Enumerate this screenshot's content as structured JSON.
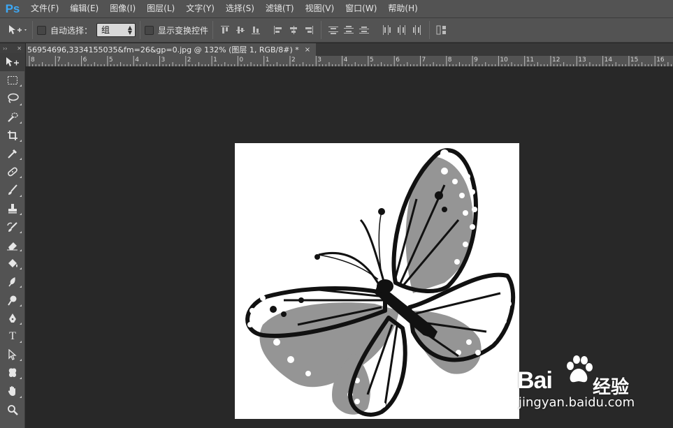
{
  "app": {
    "logo": "Ps"
  },
  "menu": [
    "文件(F)",
    "编辑(E)",
    "图像(I)",
    "图层(L)",
    "文字(Y)",
    "选择(S)",
    "滤镜(T)",
    "视图(V)",
    "窗口(W)",
    "帮助(H)"
  ],
  "options": {
    "auto_select_label": "自动选择：",
    "auto_select_value": "组",
    "show_transform_label": "显示变换控件"
  },
  "toolpanel": {
    "collapse": "››",
    "close": "✕"
  },
  "document": {
    "tab_title": "56954696,3334155035&fm=26&gp=0.jpg @ 132% (图层 1, RGB/8#) *",
    "close": "×"
  },
  "ruler": {
    "labels": [
      "8",
      "7",
      "6",
      "5",
      "4",
      "3",
      "2",
      "1",
      "0",
      "1",
      "2",
      "3",
      "4",
      "5",
      "6",
      "7",
      "8",
      "9",
      "10",
      "11",
      "12",
      "13",
      "14",
      "15",
      "16"
    ]
  },
  "tools": {
    "type_glyph": "T"
  },
  "watermark": {
    "brand": "Bai",
    "brand_cn": "经验",
    "url": "jingyan.baidu.com"
  },
  "colors": {
    "panel": "#535353",
    "canvas": "#282828",
    "accent": "#3da8f5"
  }
}
